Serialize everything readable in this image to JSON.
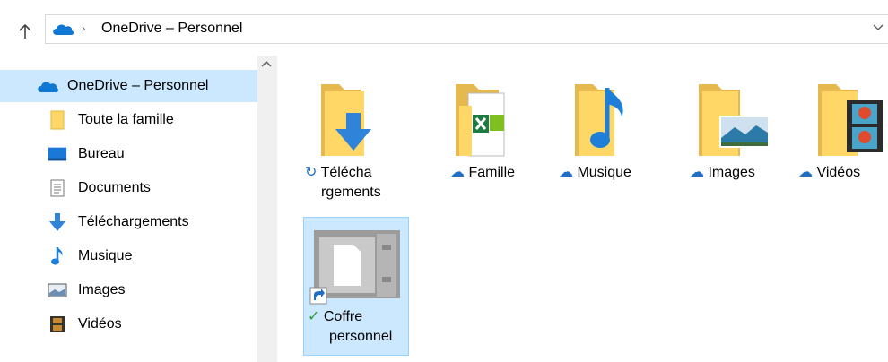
{
  "address": {
    "separator": "›",
    "location": "OneDrive – Personnel"
  },
  "nav": {
    "items": [
      {
        "label": "OneDrive – Personnel",
        "icon": "onedrive-cloud-icon"
      },
      {
        "label": "Toute la famille",
        "icon": "folder-icon"
      },
      {
        "label": "Bureau",
        "icon": "desktop-icon"
      },
      {
        "label": "Documents",
        "icon": "document-icon"
      },
      {
        "label": "Téléchargements",
        "icon": "download-arrow-icon"
      },
      {
        "label": "Musique",
        "icon": "music-note-icon"
      },
      {
        "label": "Images",
        "icon": "image-icon"
      },
      {
        "label": "Vidéos",
        "icon": "film-icon"
      }
    ]
  },
  "content": {
    "tiles": [
      {
        "line1": "Télécha",
        "line2": "rgements",
        "status": "sync-icon"
      },
      {
        "line1": "Famille",
        "status": "cloud-status-icon"
      },
      {
        "line1": "Musique",
        "status": "cloud-status-icon"
      },
      {
        "line1": "Images",
        "status": "cloud-status-icon"
      },
      {
        "line1": "Vidéos",
        "status": "cloud-status-icon"
      },
      {
        "line1": "Coffre",
        "line2": "personnel",
        "status": "available-check-icon"
      }
    ]
  },
  "colors": {
    "selection": "#cce8ff",
    "onedrive_blue": "#0f78d4",
    "folder_yellow": "#ffd767"
  }
}
